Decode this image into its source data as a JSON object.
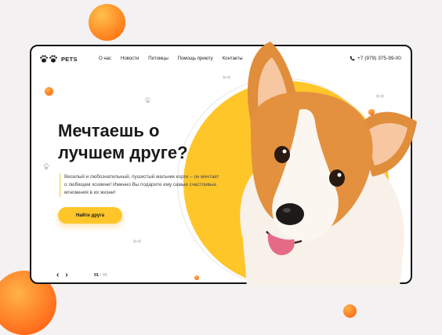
{
  "brand": {
    "name": "PETS",
    "logo_icon": "paw-prints-icon"
  },
  "nav": {
    "items": [
      "О нас",
      "Новости",
      "Питомцы",
      "Помощь приюту",
      "Контакты"
    ],
    "phone": "+7 (979) 375-99-00",
    "phone_icon": "phone-icon"
  },
  "hero": {
    "title_line1": "Мечтаешь о",
    "title_line2": "лучшем друге?",
    "description": "Веселый и любознательный, пушистый мальчик корги – он мечтает о любящем хозяине! Именно Вы подарите ему самые счастливые мгновения в их жизни!",
    "cta_label": "Найти друга",
    "image": "corgi-dog-photo"
  },
  "slider": {
    "prev_icon": "chevron-left-icon",
    "next_icon": "chevron-right-icon",
    "current": "01",
    "separator": "/",
    "total": "05"
  },
  "colors": {
    "accent": "#ffc62a",
    "orange": "#ff7a17",
    "text": "#1a1a1a",
    "frame": "#151515"
  }
}
